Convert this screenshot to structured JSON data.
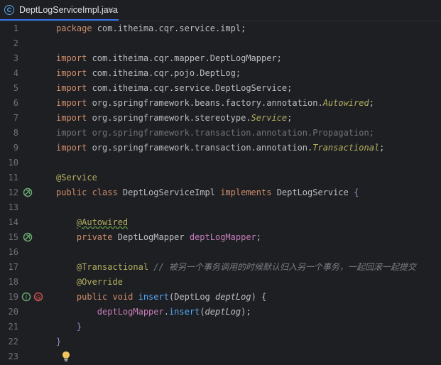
{
  "tab": {
    "title": "DeptLogServiceImpl.java",
    "icon": "C"
  },
  "colors": {
    "keyword": "#cf8e6d",
    "annotation": "#b3ae60",
    "italic_type": "#b3ae60",
    "method": "#56a8f5",
    "comment": "#7a7e85",
    "default": "#bcbec4",
    "unused": "#6f737a",
    "param": "#bcbec4"
  },
  "lines": [
    {
      "n": "1",
      "tokens": [
        {
          "t": "package ",
          "c": "kw"
        },
        {
          "t": "com.itheima.cqr.service.impl;",
          "c": "df"
        }
      ]
    },
    {
      "n": "2",
      "tokens": []
    },
    {
      "n": "3",
      "tokens": [
        {
          "t": "import ",
          "c": "kw"
        },
        {
          "t": "com.itheima.cqr.mapper.DeptLogMapper;",
          "c": "df"
        }
      ]
    },
    {
      "n": "4",
      "tokens": [
        {
          "t": "import ",
          "c": "kw"
        },
        {
          "t": "com.itheima.cqr.pojo.DeptLog;",
          "c": "df"
        }
      ]
    },
    {
      "n": "5",
      "tokens": [
        {
          "t": "import ",
          "c": "kw"
        },
        {
          "t": "com.itheima.cqr.service.DeptLogService;",
          "c": "df"
        }
      ]
    },
    {
      "n": "6",
      "tokens": [
        {
          "t": "import ",
          "c": "kw"
        },
        {
          "t": "org.springframework.beans.factory.annotation.",
          "c": "df"
        },
        {
          "t": "Autowired",
          "c": "it"
        },
        {
          "t": ";",
          "c": "df"
        }
      ]
    },
    {
      "n": "7",
      "tokens": [
        {
          "t": "import ",
          "c": "kw"
        },
        {
          "t": "org.springframework.stereotype.",
          "c": "df"
        },
        {
          "t": "Service",
          "c": "it"
        },
        {
          "t": ";",
          "c": "df"
        }
      ]
    },
    {
      "n": "8",
      "tokens": [
        {
          "t": "import org.springframework.transaction.annotation.Propagation;",
          "c": "un"
        }
      ]
    },
    {
      "n": "9",
      "tokens": [
        {
          "t": "import ",
          "c": "kw"
        },
        {
          "t": "org.springframework.transaction.annotation.",
          "c": "df"
        },
        {
          "t": "Transactional",
          "c": "it"
        },
        {
          "t": ";",
          "c": "df"
        }
      ]
    },
    {
      "n": "10",
      "tokens": []
    },
    {
      "n": "11",
      "tokens": [
        {
          "t": "@Service",
          "c": "an"
        }
      ]
    },
    {
      "n": "12",
      "tokens": [
        {
          "t": "public class ",
          "c": "kw"
        },
        {
          "t": "DeptLogServiceImpl ",
          "c": "df"
        },
        {
          "t": "implements ",
          "c": "kw"
        },
        {
          "t": "DeptLogService ",
          "c": "df"
        },
        {
          "t": "{",
          "c": "br"
        }
      ],
      "gutter": "bean"
    },
    {
      "n": "13",
      "tokens": []
    },
    {
      "n": "14",
      "tokens": [
        {
          "t": "    ",
          "c": "df"
        },
        {
          "t": "@Autowired",
          "c": "anw"
        }
      ]
    },
    {
      "n": "15",
      "tokens": [
        {
          "t": "    ",
          "c": "df"
        },
        {
          "t": "private ",
          "c": "kw"
        },
        {
          "t": "DeptLogMapper ",
          "c": "df"
        },
        {
          "t": "deptLogMapper",
          "c": "fd"
        },
        {
          "t": ";",
          "c": "df"
        }
      ],
      "gutter": "bean"
    },
    {
      "n": "16",
      "tokens": []
    },
    {
      "n": "17",
      "tokens": [
        {
          "t": "    ",
          "c": "df"
        },
        {
          "t": "@Transactional",
          "c": "an"
        },
        {
          "t": " // 被另一个事务调用的时候默认归入另一个事务，一起回滚一起提交",
          "c": "cm"
        }
      ]
    },
    {
      "n": "18",
      "tokens": [
        {
          "t": "    ",
          "c": "df"
        },
        {
          "t": "@Override",
          "c": "an"
        }
      ]
    },
    {
      "n": "19",
      "tokens": [
        {
          "t": "    ",
          "c": "df"
        },
        {
          "t": "public void ",
          "c": "kw"
        },
        {
          "t": "insert",
          "c": "mt"
        },
        {
          "t": "(DeptLog ",
          "c": "df"
        },
        {
          "t": "deptLog",
          "c": "pm"
        },
        {
          "t": ") {",
          "c": "df"
        }
      ],
      "gutter": "override"
    },
    {
      "n": "20",
      "tokens": [
        {
          "t": "        ",
          "c": "df"
        },
        {
          "t": "deptLogMapper",
          "c": "fd"
        },
        {
          "t": ".",
          "c": "df"
        },
        {
          "t": "insert",
          "c": "mt"
        },
        {
          "t": "(",
          "c": "df"
        },
        {
          "t": "deptLog",
          "c": "pm"
        },
        {
          "t": ");",
          "c": "df"
        }
      ]
    },
    {
      "n": "21",
      "tokens": [
        {
          "t": "    ",
          "c": "df"
        },
        {
          "t": "}",
          "c": "br"
        }
      ]
    },
    {
      "n": "22",
      "tokens": [
        {
          "t": "}",
          "c": "br"
        }
      ]
    },
    {
      "n": "23",
      "tokens": [],
      "bulb": true
    }
  ]
}
